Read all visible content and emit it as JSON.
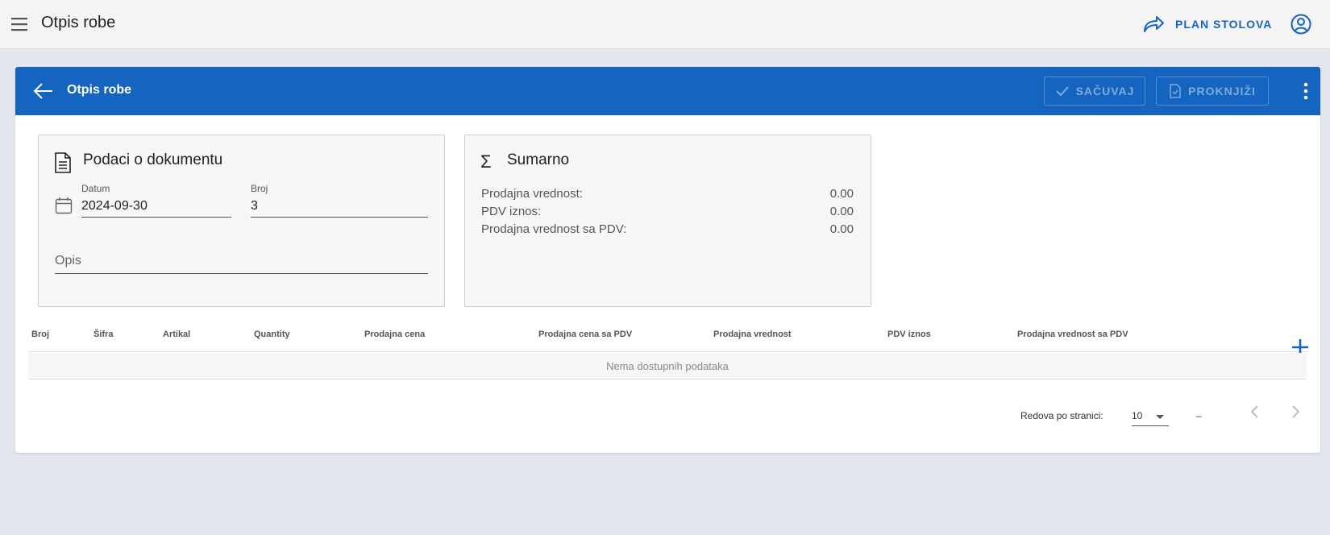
{
  "appbar": {
    "title": "Otpis robe",
    "plan_label": "PLAN STOLOVA",
    "icons": {
      "menu": "menu-icon",
      "plan": "forward-arrow-icon",
      "account": "account-circle-icon"
    }
  },
  "card": {
    "title": "Otpis robe",
    "save_label": "SAČUVAJ",
    "post_label": "PROKNJIŽI",
    "accent_color": "#1565c0"
  },
  "doc_panel": {
    "title": "Podaci o dokumentu",
    "datum_label": "Datum",
    "datum_value": "2024-09-30",
    "broj_label": "Broj",
    "broj_value": "3",
    "opis_placeholder": "Opis",
    "opis_value": ""
  },
  "sum_panel": {
    "title": "Sumarno",
    "sigma": "Σ",
    "rows": [
      {
        "label": "Prodajna vrednost:",
        "value": "0.00"
      },
      {
        "label": "PDV iznos:",
        "value": "0.00"
      },
      {
        "label": "Prodajna vrednost sa PDV:",
        "value": "0.00"
      }
    ]
  },
  "table": {
    "columns": [
      "Broj",
      "Šifra",
      "Artikal",
      "Quantity",
      "Prodajna cena",
      "Prodajna cena sa PDV",
      "Prodajna vrednost",
      "PDV iznos",
      "Prodajna vrednost sa PDV"
    ],
    "empty_text": "Nema dostupnih podataka"
  },
  "pagination": {
    "rows_label": "Redova po stranici:",
    "rows_per_page": "10",
    "range_text": "–"
  }
}
